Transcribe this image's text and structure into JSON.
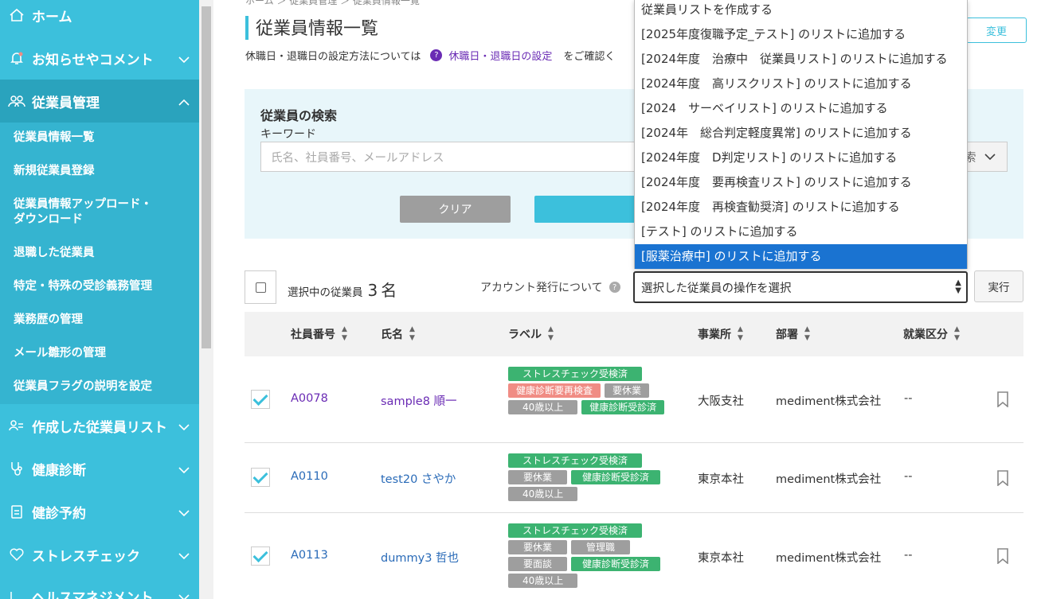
{
  "sidebar": {
    "home": "ホーム",
    "notices": "お知らせやコメント",
    "employee_mgmt": "従業員管理",
    "sub_items": [
      "従業員情報一覧",
      "新規従業員登録",
      "従業員情報アップロード・",
      "ダウンロード",
      "退職した従業員",
      "特定・特殊の受診義務管理",
      "業務歴の管理",
      "メール雛形の管理",
      "従業員フラグの説明を設定"
    ],
    "created_lists": "作成した従業員リスト",
    "health_check": "健康診断",
    "reservation": "健診予約",
    "stress_check": "ストレスチェック",
    "health_mgmt": "ヘルスマネジメント"
  },
  "page": {
    "breadcrumb": "ホーム ＞ 従業員管理 ＞ 従業員情報一覧",
    "title": "従業員情報一覧",
    "info_prefix": "休職日・退職日の設定方法については",
    "info_q": "?",
    "info_link": "休職日・退職日の設定",
    "info_suffix": "をご確認く",
    "change_button": "変更"
  },
  "search": {
    "title": "従業員の検索",
    "keyword_label": "キーワード",
    "keyword_placeholder": "氏名、社員番号、メールアドレス",
    "right_select": "索",
    "clear_button": "クリア"
  },
  "bulk": {
    "selected_label": "選択中の従業員",
    "selected_count": "3",
    "selected_unit": "名",
    "account_label": "アカウント発行について",
    "account_q": "?",
    "operation_value": "選択した従業員の操作を選択",
    "execute_button": "実行"
  },
  "table": {
    "headers": [
      "社員番号",
      "氏名",
      "ラベル",
      "事業所",
      "部署",
      "就業区分"
    ],
    "rows": [
      {
        "id": "A0078",
        "name": "sample8 順一",
        "labels": [
          "ストレスチェック受検済",
          "健康診断要再検査",
          "要休業",
          "40歳以上",
          "健康診断受診済"
        ],
        "office": "大阪支社",
        "dept": "mediment株式会社",
        "emp": "--"
      },
      {
        "id": "A0110",
        "name": "test20 さやか",
        "labels": [
          "ストレスチェック受検済",
          "要休業",
          "健康診断受診済",
          "40歳以上"
        ],
        "office": "東京本社",
        "dept": "mediment株式会社",
        "emp": "--"
      },
      {
        "id": "A0113",
        "name": "dummy3 哲也",
        "labels": [
          "ストレスチェック受検済",
          "要休業",
          "管理職",
          "要面談",
          "健康診断受診済",
          "40歳以上"
        ],
        "office": "東京本社",
        "dept": "mediment株式会社",
        "emp": "--"
      }
    ]
  },
  "dropdown": {
    "options": [
      "従業員リストを作成する",
      "[2025年度復職予定_テスト] のリストに追加する",
      "[2024年度　治療中　従業員リスト] のリストに追加する",
      "[2024年度　高リスクリスト] のリストに追加する",
      "[2024　サーベイリスト] のリストに追加する",
      "[2024年　総合判定軽度異常] のリストに追加する",
      "[2024年度　D判定リスト] のリストに追加する",
      "[2024年度　要再検査リスト] のリストに追加する",
      "[2024年度　再検査勧奨済] のリストに追加する",
      "[テスト] のリストに追加する",
      "[服薬治療中] のリストに追加する"
    ],
    "highlighted_index": 10
  },
  "colors": {
    "accent": "#3cc0dc",
    "purple_link": "#6a2bb4",
    "highlight": "#1a73d1",
    "tag_green": "#3cb371",
    "tag_pink": "#f08c84",
    "tag_gray": "#9e9e9e"
  }
}
